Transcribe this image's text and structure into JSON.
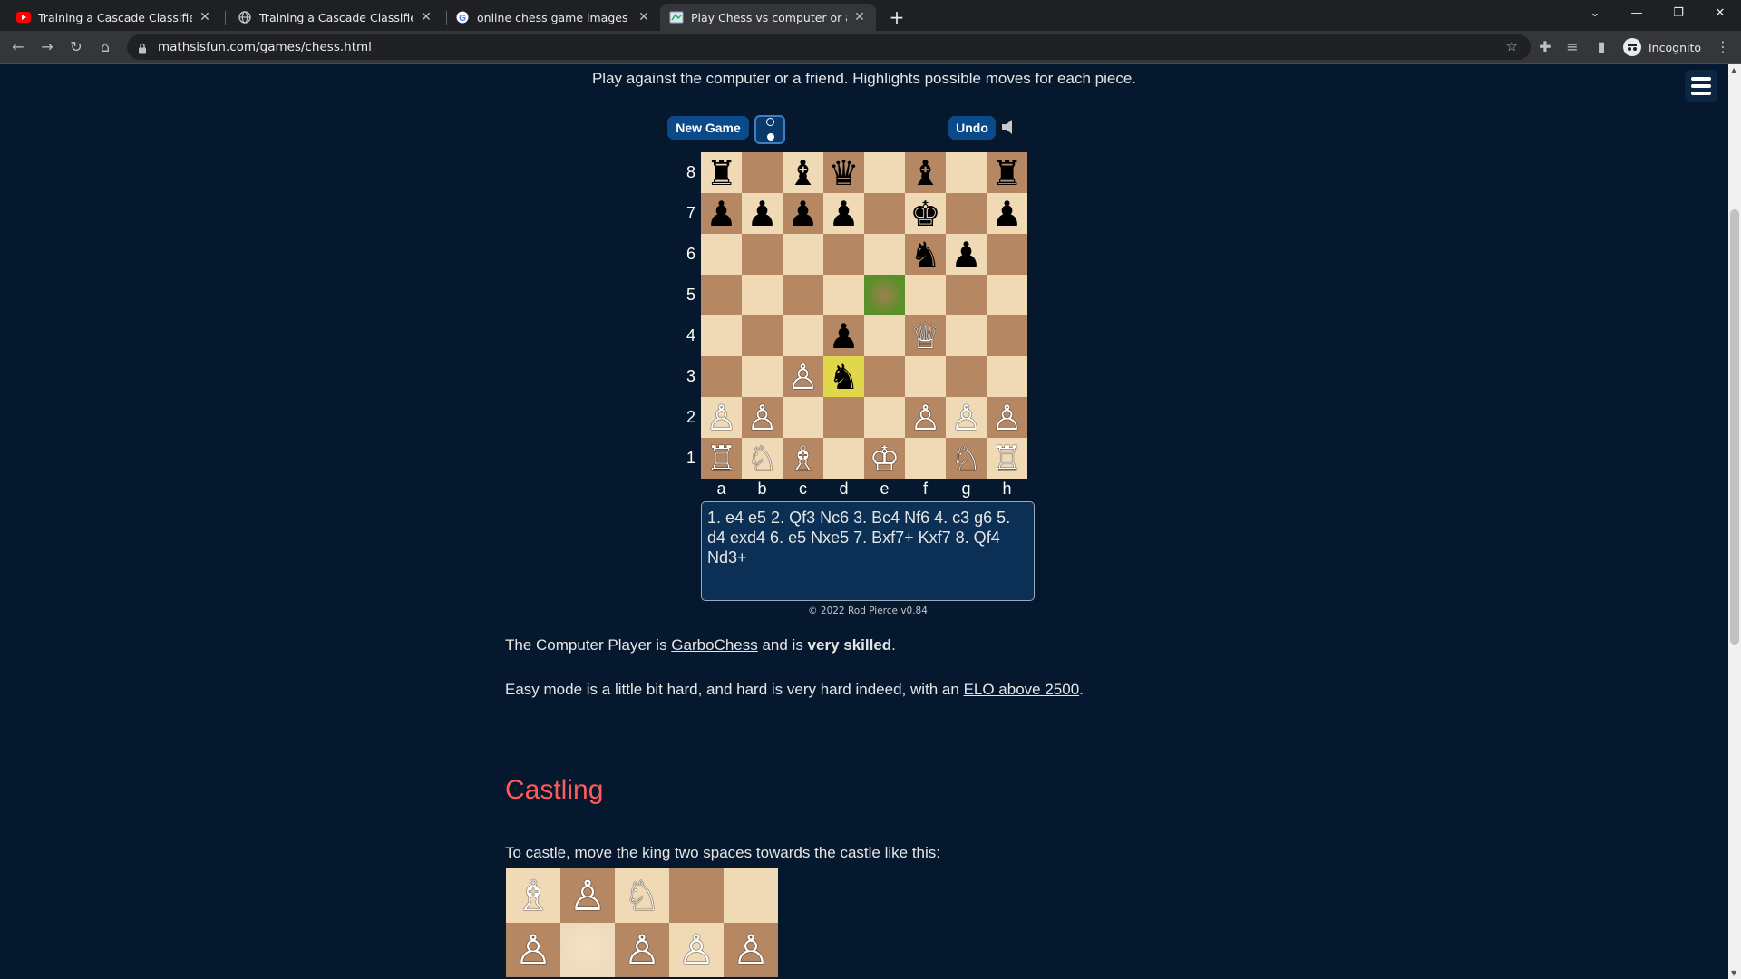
{
  "browser": {
    "tabs": [
      {
        "title": "Training a Cascade Classifier - Op",
        "icon": "youtube-icon"
      },
      {
        "title": "Training a Cascade Classifier - Le",
        "icon": "globe-icon"
      },
      {
        "title": "online chess game images - Goo",
        "icon": "google-icon"
      },
      {
        "title": "Play Chess vs computer or a frien",
        "icon": "mathsisfun-icon",
        "active": true
      }
    ],
    "url": "mathsisfun.com/games/chess.html",
    "profile_label": "Incognito"
  },
  "page": {
    "intro": "Play against the computer or a friend. Highlights possible moves for each piece.",
    "new_game_label": "New Game",
    "undo_label": "Undo",
    "ranks": [
      "8",
      "7",
      "6",
      "5",
      "4",
      "3",
      "2",
      "1"
    ],
    "files": [
      "a",
      "b",
      "c",
      "d",
      "e",
      "f",
      "g",
      "h"
    ],
    "board": [
      [
        "♜",
        "",
        "♝",
        "♛",
        "",
        "♝",
        "",
        "♜"
      ],
      [
        "♟",
        "♟",
        "♟",
        "♟",
        "",
        "♚",
        "",
        "♟"
      ],
      [
        "",
        "",
        "",
        "",
        "",
        "♞",
        "♟",
        ""
      ],
      [
        "",
        "",
        "",
        "",
        "",
        "",
        "",
        ""
      ],
      [
        "",
        "",
        "",
        "♟",
        "",
        "♕",
        "",
        ""
      ],
      [
        "",
        "",
        "♙",
        "♞",
        "",
        "",
        "",
        ""
      ],
      [
        "♙",
        "♙",
        "",
        "",
        "",
        "♙",
        "♙",
        "♙"
      ],
      [
        "♖",
        "♘",
        "♗",
        "",
        "♔",
        "",
        "♘",
        "♖"
      ]
    ],
    "highlight_from": "e5",
    "highlight_to": "d3",
    "colors": {
      "light_square": "#f0d9b5",
      "dark_square": "#b58863",
      "highlight_green": "#5a8f2a",
      "highlight_yellow": "#e0d84a",
      "heading_red": "#ff5a5a"
    },
    "moves_text": "1. e4 e5  2. Qf3 Nc6  3. Bc4 Nf6  4. c3 g6  5. d4 exd4  6. e5 Nxe5  7. Bxf7+ Kxf7  8. Qf4 Nd3+",
    "copyright": "© 2022 Rod Pierce v0.84",
    "para1_a": "The Computer Player is ",
    "para1_link": "GarboChess",
    "para1_b": " and is ",
    "para1_bold": "very skilled",
    "para1_c": ".",
    "para2_a": "Easy mode is a little bit hard, and hard is very hard indeed, with an ",
    "para2_link": "ELO above 2500",
    "para2_b": ".",
    "castling_heading": "Castling",
    "castling_text": "To castle, move the king two spaces towards the castle like this:",
    "diagram": [
      [
        "♗",
        "♙",
        "♘",
        "",
        ""
      ],
      [
        "♙",
        "",
        "♙",
        "♙",
        "♙"
      ]
    ]
  }
}
